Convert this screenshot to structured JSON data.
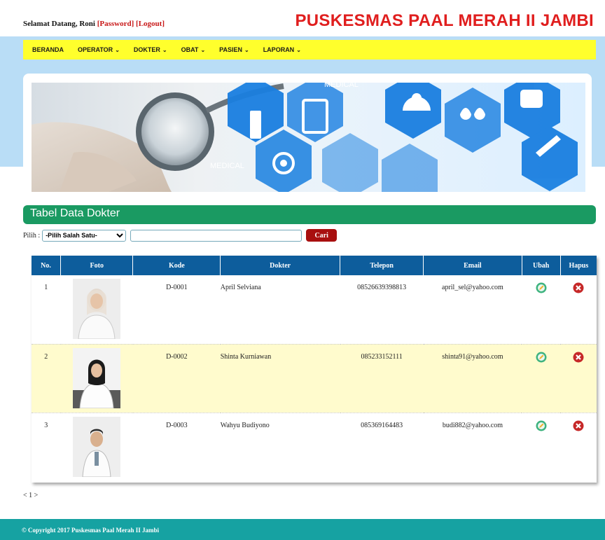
{
  "header": {
    "welcome_prefix": "Selamat Datang, Roni",
    "password_link": "[Password]",
    "logout_link": "[Logout]",
    "site_title": "PUSKESMAS PAAL MERAH II JAMBI"
  },
  "nav": {
    "items": [
      {
        "label": "BERANDA",
        "dropdown": false
      },
      {
        "label": "OPERATOR",
        "dropdown": true
      },
      {
        "label": "DOKTER",
        "dropdown": true
      },
      {
        "label": "OBAT",
        "dropdown": true
      },
      {
        "label": "PASIEN",
        "dropdown": true
      },
      {
        "label": "LAPORAN",
        "dropdown": true
      }
    ]
  },
  "banner": {
    "text1": "MEDICAL",
    "text2": "MEDICAL"
  },
  "section": {
    "title": "Tabel Data Dokter"
  },
  "filter": {
    "label": "Pilih :",
    "select_value": "-Pilih Salah Satu-",
    "search_value": "",
    "search_button": "Cari"
  },
  "table": {
    "headers": [
      "No.",
      "Foto",
      "Kode",
      "Dokter",
      "Telepon",
      "Email",
      "Ubah",
      "Hapus"
    ],
    "rows": [
      {
        "no": "1",
        "kode": "D-0001",
        "dokter": "April Selviana",
        "telepon": "08526639398813",
        "email": "april_sel@yahoo.com"
      },
      {
        "no": "2",
        "kode": "D-0002",
        "dokter": "Shinta Kurniawan",
        "telepon": "085233152111",
        "email": "shinta91@yahoo.com"
      },
      {
        "no": "3",
        "kode": "D-0003",
        "dokter": "Wahyu Budiyono",
        "telepon": "085369164483",
        "email": "budi882@yahoo.com"
      }
    ]
  },
  "pager": {
    "prev": "<",
    "page": "1",
    "next": ">"
  },
  "footer": {
    "text": "© Copyright 2017 Puskesmas Paal Merah II Jambi"
  },
  "colors": {
    "accent_red": "#e01e1e",
    "nav_yellow": "#ffff2c",
    "section_green": "#1a9a62",
    "table_header_blue": "#0d5d9c",
    "footer_teal": "#16a2a2"
  }
}
